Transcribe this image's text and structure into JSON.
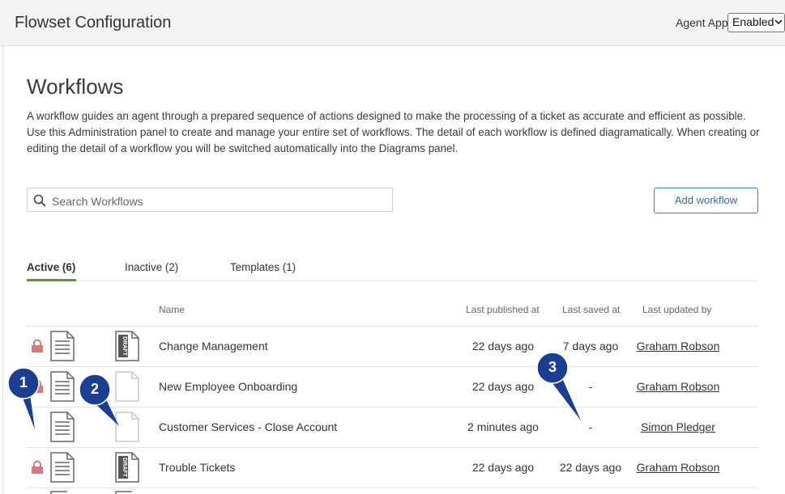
{
  "header": {
    "title": "Flowset Configuration",
    "agent_app_label": "Agent App",
    "agent_app_value": "Enabled"
  },
  "main": {
    "title": "Workflows",
    "description": "A workflow guides an agent through a prepared sequence of actions designed to make the processing of a ticket as accurate and efficient as possible. Use this Administration panel to create and manage your entire set of workflows. The detail of each workflow is defined diagramatically. When creating or editing the detail of a workflow you will be switched automatically into the Diagrams panel.",
    "search_placeholder": "Search Workflows",
    "add_label": "Add workflow"
  },
  "tabs": [
    {
      "label": "Active (6)"
    },
    {
      "label": "Inactive (2)"
    },
    {
      "label": "Templates (1)"
    }
  ],
  "table": {
    "columns": {
      "name": "Name",
      "published": "Last published at",
      "saved": "Last saved at",
      "updated_by": "Last updated by"
    },
    "rows": [
      {
        "name": "Change Management",
        "published": "22 days ago",
        "saved": "7 days ago",
        "updated_by": "Graham Robson",
        "locked": true,
        "draft": true
      },
      {
        "name": "New Employee Onboarding",
        "published": "22 days ago",
        "saved": "-",
        "updated_by": "Graham Robson",
        "locked": true,
        "draft": false
      },
      {
        "name": "Customer Services - Close Account",
        "published": "2 minutes ago",
        "saved": "-",
        "updated_by": "Simon Pledger",
        "locked": false,
        "draft": false
      },
      {
        "name": "Trouble Tickets",
        "published": "22 days ago",
        "saved": "22 days ago",
        "updated_by": "Graham Robson",
        "locked": true,
        "draft": true
      }
    ]
  },
  "callouts": [
    {
      "label": "1"
    },
    {
      "label": "2"
    },
    {
      "label": "3"
    }
  ],
  "icons": {
    "lock": "lock-icon",
    "document": "document-icon",
    "draft": "draft-document-icon",
    "blank": "blank-document-icon",
    "search": "search-icon",
    "chevron": "chevron-down-icon"
  },
  "colors": {
    "accent_tab": "#5a9a1d",
    "button_border": "#3d7fb0",
    "lock": "#d9777a",
    "callout": "#1a3f91"
  }
}
